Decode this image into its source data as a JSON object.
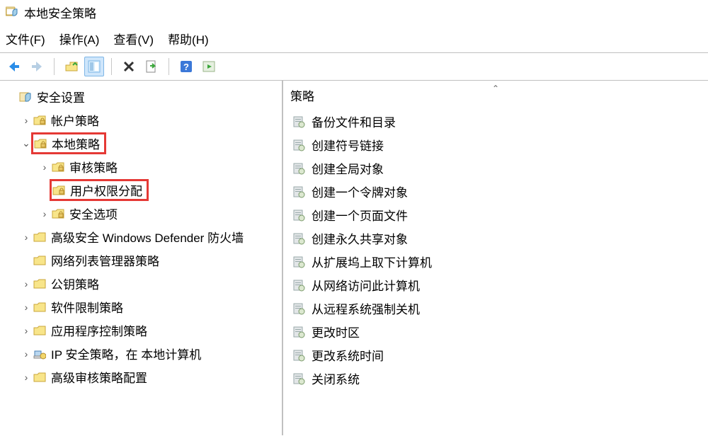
{
  "window": {
    "title": "本地安全策略"
  },
  "menu": {
    "file": "文件(F)",
    "action": "操作(A)",
    "view": "查看(V)",
    "help": "帮助(H)"
  },
  "tree": {
    "root": "安全设置",
    "items": {
      "account": "帐户策略",
      "local": "本地策略",
      "audit": "审核策略",
      "user_rights": "用户权限分配",
      "security_options": "安全选项",
      "defender": "高级安全 Windows Defender 防火墙",
      "netlist": "网络列表管理器策略",
      "pubkey": "公钥策略",
      "softrestrict": "软件限制策略",
      "appctrl": "应用程序控制策略",
      "ipsec": "IP 安全策略，在 本地计算机",
      "advaudit": "高级审核策略配置"
    }
  },
  "right": {
    "header": "策略",
    "items": {
      "0": "备份文件和目录",
      "1": "创建符号链接",
      "2": "创建全局对象",
      "3": "创建一个令牌对象",
      "4": "创建一个页面文件",
      "5": "创建永久共享对象",
      "6": "从扩展坞上取下计算机",
      "7": "从网络访问此计算机",
      "8": "从远程系统强制关机",
      "9": "更改时区",
      "10": "更改系统时间",
      "11": "关闭系统"
    }
  }
}
